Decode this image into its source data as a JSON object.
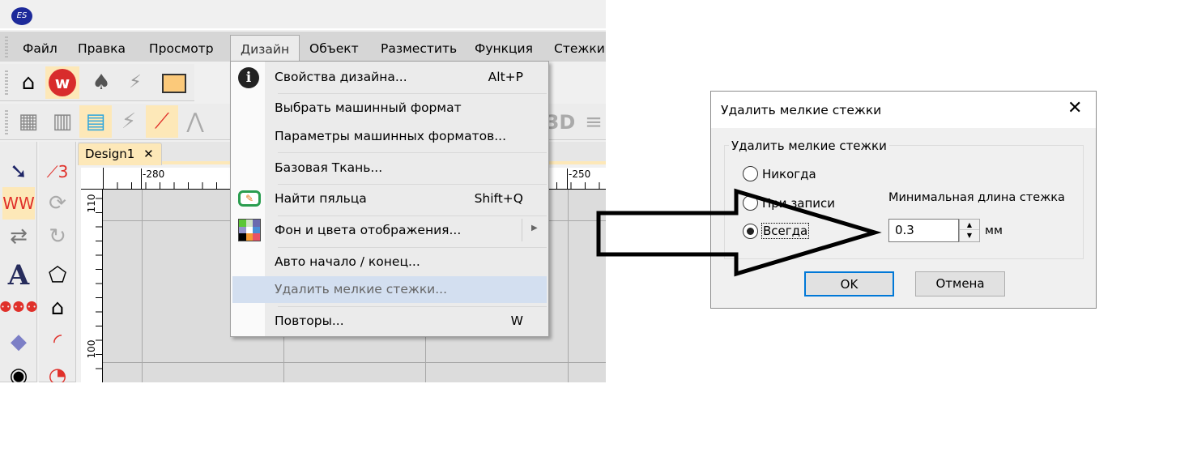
{
  "app": {
    "logo_text": "ES"
  },
  "menubar": [
    {
      "label": "Файл"
    },
    {
      "label": "Правка"
    },
    {
      "label": "Просмотр"
    },
    {
      "label": "Дизайн",
      "active": true
    },
    {
      "label": "Объект"
    },
    {
      "label": "Разместить"
    },
    {
      "label": "Функция"
    },
    {
      "label": "Стежки"
    }
  ],
  "toolbar": {
    "icons": [
      "home-icon",
      "wilcom-icon",
      "corel-balloon-icon",
      "convert-icon",
      "folders-icon"
    ],
    "stitch_icons": [
      "tatami-icon",
      "satin-column-icon",
      "blackwork-icon",
      "zigzag-icon",
      "radial-fill-icon",
      "tree-icon",
      "3d-label"
    ],
    "label_3d": "3D"
  },
  "tabs": [
    {
      "label": "Design1",
      "close": "✕"
    }
  ],
  "ruler": {
    "h_labels": [
      "-280",
      "-250"
    ],
    "v_labels": [
      "110",
      "100"
    ]
  },
  "design_menu": {
    "items": [
      {
        "label": "Свойства дизайна...",
        "shortcut": "Alt+P",
        "icon": "info-icon"
      },
      {
        "label": "Выбрать машинный формат"
      },
      {
        "label": "Параметры машинных форматов..."
      },
      {
        "label": "Базовая Ткань..."
      },
      {
        "label": "Найти пяльца",
        "shortcut": "Shift+Q",
        "icon": "hoop-icon"
      },
      {
        "label": "Фон и цвета отображения...",
        "submenu": true,
        "icon": "color-grid-icon"
      },
      {
        "label": "Авто начало / конец..."
      },
      {
        "label": "Удалить мелкие стежки...",
        "highlighted": true
      },
      {
        "label": "Повторы...",
        "shortcut": "W"
      }
    ]
  },
  "dialog": {
    "title": "Удалить мелкие стежки",
    "group_label": "Удалить мелкие стежки",
    "options": [
      {
        "label": "Никогда",
        "checked": false
      },
      {
        "label": "При записи",
        "checked": false
      },
      {
        "label": "Всегда",
        "checked": true
      }
    ],
    "min_length_label": "Минимальная длина стежка",
    "min_length_value": "0.3",
    "unit": "мм",
    "ok_label": "OK",
    "cancel_label": "Отмена"
  },
  "colors": {
    "highlight": "#d3dff0",
    "ok_border": "#0078d7",
    "toolbar_active": "#fde8b8"
  }
}
